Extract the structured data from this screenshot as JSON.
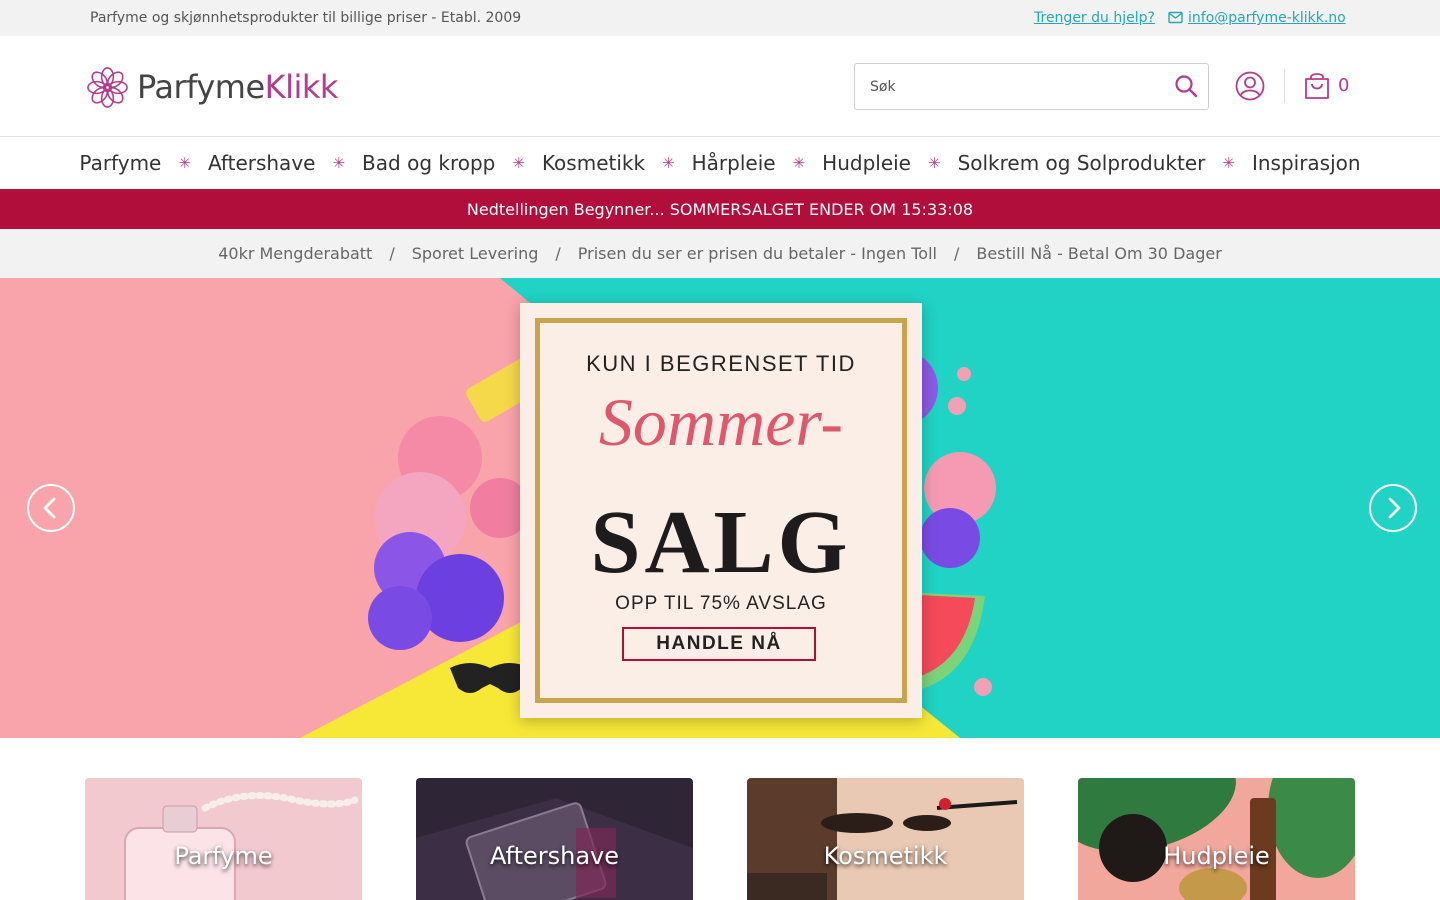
{
  "topbar": {
    "tagline": "Parfyme og skjønnhetsprodukter til billige priser - Etabl. 2009",
    "help_link": "Trenger du hjelp?",
    "email": "info@parfyme-klikk.no"
  },
  "header": {
    "logo": {
      "part1": "Parfyme",
      "part2": "Klikk"
    },
    "search": {
      "placeholder": "Søk",
      "value": ""
    },
    "cart_count": "0"
  },
  "nav": {
    "items": [
      "Parfyme",
      "Aftershave",
      "Bad og kropp",
      "Kosmetikk",
      "Hårpleie",
      "Hudpleie",
      "Solkrem og Solprodukter",
      "Inspirasjon"
    ],
    "separator": "✳"
  },
  "countdown": {
    "text": "Nedtellingen Begynner... SOMMERSALGET ENDER OM 15:33:08"
  },
  "usp": {
    "items": [
      "40kr Mengderabatt",
      "Sporet Levering",
      "Prisen du ser er prisen du betaler - Ingen Toll",
      "Bestill Nå - Betal Om 30 Dager"
    ],
    "separator": "/"
  },
  "hero": {
    "line1": "KUN I BEGRENSET TID",
    "script": "Sommer-",
    "big": "SALG",
    "line3": "OPP TIL 75% AVSLAG",
    "cta": "HANDLE NÅ"
  },
  "tiles": [
    {
      "label": "Parfyme"
    },
    {
      "label": "Aftershave"
    },
    {
      "label": "Kosmetikk"
    },
    {
      "label": "Hudpleie"
    }
  ],
  "colors": {
    "brand": "#b63b8c",
    "accent_link": "#25a7b8",
    "countdown_bg": "#b10e3c",
    "hero_pink": "#f9a3ab",
    "hero_teal": "#20d3c4",
    "hero_yellow": "#f7e837"
  },
  "icons": [
    "mail-icon",
    "logo-flower-icon",
    "search-icon",
    "user-icon",
    "cart-icon",
    "chevron-left-icon",
    "chevron-right-icon"
  ]
}
